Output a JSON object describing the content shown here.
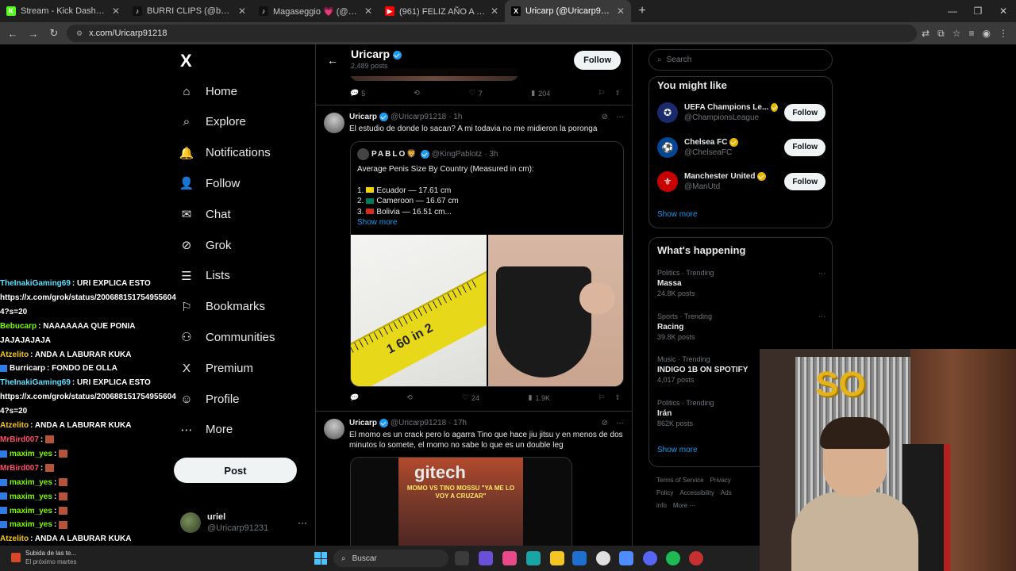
{
  "browser": {
    "tabs": [
      {
        "label": "Stream - Kick Dashboard",
        "fav": "K",
        "color": "#53fc18",
        "active": false
      },
      {
        "label": "BURRI CLIPS (@burricarp) | TikT",
        "fav": "♪",
        "color": "#111111",
        "active": false
      },
      {
        "label": "Magaseggio 💗 (@magaseggio",
        "fav": "♪",
        "color": "#111111",
        "active": false
      },
      {
        "label": "(961) FELIZ AÑO A TODOS😊🍾",
        "fav": "▶",
        "color": "#ff0000",
        "active": false
      },
      {
        "label": "Uricarp (@Uricarp91218) / X",
        "fav": "X",
        "color": "#000000",
        "active": true
      }
    ],
    "url": "x.com/Uricarp91218"
  },
  "nav": {
    "logo": "X",
    "items": [
      {
        "label": "Home",
        "icon": "home-icon",
        "glyph": "⌂"
      },
      {
        "label": "Explore",
        "icon": "search-icon",
        "glyph": "⌕"
      },
      {
        "label": "Notifications",
        "icon": "bell-icon",
        "glyph": "🔔"
      },
      {
        "label": "Follow",
        "icon": "person-plus-icon",
        "glyph": "👤"
      },
      {
        "label": "Chat",
        "icon": "mail-icon",
        "glyph": "✉"
      },
      {
        "label": "Grok",
        "icon": "grok-icon",
        "glyph": "⊘"
      },
      {
        "label": "Lists",
        "icon": "list-icon",
        "glyph": "☰"
      },
      {
        "label": "Bookmarks",
        "icon": "bookmark-icon",
        "glyph": "⚐"
      },
      {
        "label": "Communities",
        "icon": "people-icon",
        "glyph": "⚇"
      },
      {
        "label": "Premium",
        "icon": "x-premium-icon",
        "glyph": "X"
      },
      {
        "label": "Profile",
        "icon": "profile-icon",
        "glyph": "☺"
      },
      {
        "label": "More",
        "icon": "more-circle-icon",
        "glyph": "⋯"
      }
    ],
    "post_label": "Post",
    "account": {
      "name": "uriel",
      "handle": "@Uricarp91231"
    }
  },
  "chat": [
    {
      "user": "TheInakiGaming69",
      "color": "#5ee1ff",
      "badge": false,
      "msg": ": URI EXPLICA ESTO"
    },
    {
      "user": "",
      "color": "#ffffff",
      "badge": false,
      "msg": "https://x.com/grok/status/200688151754955604"
    },
    {
      "user": "",
      "color": "#ffffff",
      "badge": false,
      "msg": "4?s=20"
    },
    {
      "user": "Bebucarp",
      "color": "#7cfc00",
      "badge": false,
      "msg": ": NAAAAAAA QUE PONIA"
    },
    {
      "user": "",
      "color": "#ffffff",
      "badge": false,
      "msg": "JAJAJAJAJA"
    },
    {
      "user": "Atzelito",
      "color": "#f5c518",
      "badge": false,
      "msg": ": ANDA A LABURAR KUKA"
    },
    {
      "user": "Burricarp",
      "color": "#ffffff",
      "badge": true,
      "msg": ": FONDO DE OLLA"
    },
    {
      "user": "TheInakiGaming69",
      "color": "#5ee1ff",
      "badge": false,
      "msg": ": URI EXPLICA ESTO"
    },
    {
      "user": "",
      "color": "#ffffff",
      "badge": false,
      "msg": "https://x.com/grok/status/200688151754955604"
    },
    {
      "user": "",
      "color": "#ffffff",
      "badge": false,
      "msg": "4?s=20"
    },
    {
      "user": "Atzelito",
      "color": "#f5c518",
      "badge": false,
      "msg": ": ANDA A LABURAR KUKA"
    },
    {
      "user": "MrBird007",
      "color": "#ff4f6d",
      "badge": false,
      "msg": ":",
      "emote": true
    },
    {
      "user": "maxim_yes",
      "color": "#7cfc00",
      "badge": true,
      "msg": ":",
      "emote": true
    },
    {
      "user": "MrBird007",
      "color": "#ff4f6d",
      "badge": false,
      "msg": ":",
      "emote": true
    },
    {
      "user": "maxim_yes",
      "color": "#7cfc00",
      "badge": true,
      "msg": ":",
      "emote": true
    },
    {
      "user": "maxim_yes",
      "color": "#7cfc00",
      "badge": true,
      "msg": ":",
      "emote": true
    },
    {
      "user": "maxim_yes",
      "color": "#7cfc00",
      "badge": true,
      "msg": ":",
      "emote": true
    },
    {
      "user": "maxim_yes",
      "color": "#7cfc00",
      "badge": true,
      "msg": ":",
      "emote": true
    },
    {
      "user": "Atzelito",
      "color": "#f5c518",
      "badge": false,
      "msg": ": ANDA A LABURAR KUKA"
    }
  ],
  "profile": {
    "name": "Uricarp",
    "posts": "2,489 posts",
    "follow_label": "Follow"
  },
  "prev_actions": {
    "replies": "5",
    "reposts": "",
    "likes": "7",
    "views": "204"
  },
  "tweet1": {
    "name": "Uricarp",
    "handle": "@Uricarp91218",
    "time": "· 1h",
    "text": "El estudio de donde lo sacan? A mi todavia no me midieron la poronga",
    "quote": {
      "name": "PABLO🦁",
      "handle": "@KingPablotz",
      "time": "· 3h",
      "title": "Average Penis Size By Country (Measured in cm):",
      "items": [
        {
          "n": "1.",
          "flag": "#f5d300",
          "text": "Ecuador — 17.61 cm"
        },
        {
          "n": "2.",
          "flag": "#007a5e",
          "text": "Cameroon — 16.67 cm"
        },
        {
          "n": "3.",
          "flag": "#d52b1e",
          "text": "Bolivia — 16.51 cm..."
        }
      ],
      "show_more": "Show more"
    },
    "tape_label": "1 60 in 2",
    "actions": {
      "replies": "",
      "reposts": "",
      "likes": "24",
      "views": "1.9K"
    }
  },
  "tweet2": {
    "name": "Uricarp",
    "handle": "@Uricarp91218",
    "time": "· 17h",
    "text": "El momo es un crack pero lo agarra Tino que hace jiu jitsu y en menos de dos minutos lo somete, el momo no sabe lo que es un double leg",
    "video_logo": "gitech",
    "video_text": "MOMO VS TINO MOSSU \"YA ME LO VOY A CRUZAR\""
  },
  "search": {
    "placeholder": "Search"
  },
  "you_might_like": {
    "title": "You might like",
    "items": [
      {
        "name": "UEFA Champions Le...",
        "handle": "@ChampionsLeague",
        "bg": "#1a2a6c",
        "glyph": "✪",
        "verified": "gold"
      },
      {
        "name": "Chelsea FC",
        "handle": "@ChelseaFC",
        "bg": "#034694",
        "glyph": "⚽",
        "verified": "gold"
      },
      {
        "name": "Manchester United",
        "handle": "@ManUtd",
        "bg": "#c70101",
        "glyph": "⚜",
        "verified": "gold"
      }
    ],
    "follow_label": "Follow",
    "show_more": "Show more"
  },
  "whats_happening": {
    "title": "What's happening",
    "items": [
      {
        "cat": "Politics · Trending",
        "name": "Massa",
        "count": "24.8K posts"
      },
      {
        "cat": "Sports · Trending",
        "name": "Racing",
        "count": "39.8K posts"
      },
      {
        "cat": "Music · Trending",
        "name": "INDIGO 1B ON SPOTIFY",
        "count": "4,017 posts"
      },
      {
        "cat": "Politics · Trending",
        "name": "Irán",
        "count": "862K posts"
      }
    ],
    "show_more": "Show more"
  },
  "footer": {
    "links": [
      "Terms of Service",
      "Privacy Policy",
      "Accessibility",
      "Ads info",
      "More ···"
    ]
  },
  "webcam": {
    "balloons": "SO"
  },
  "taskbar": {
    "notif_title": "Subida de las te...",
    "notif_sub": "El próximo martes",
    "search_label": "Buscar"
  }
}
